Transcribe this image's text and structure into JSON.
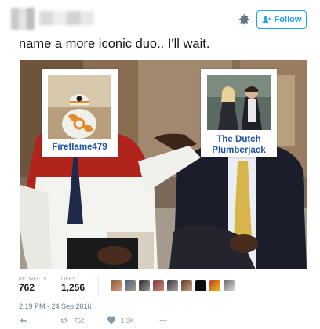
{
  "header": {
    "follow_label": "Follow",
    "icons": [
      "settings-gear-icon",
      "follow-person-icon"
    ]
  },
  "tweet": {
    "text": "name a more iconic duo.. I'll wait.",
    "timestamp": "2:19 PM - 24 Sep 2016"
  },
  "media": {
    "cards": [
      {
        "label": "Fireflame479"
      },
      {
        "label_line1": "The Dutch",
        "label_line2": "Plumberjack"
      }
    ]
  },
  "stats": {
    "retweets_label": "RETWEETS",
    "retweets_value": "762",
    "likes_label": "LIKES",
    "likes_value": "1,256"
  },
  "actions": {
    "retweet_count": "762",
    "like_count": "1.3K"
  },
  "colors": {
    "accent": "#1da1f2",
    "card_label": "#1b4fa8",
    "muted": "#8899a6"
  }
}
